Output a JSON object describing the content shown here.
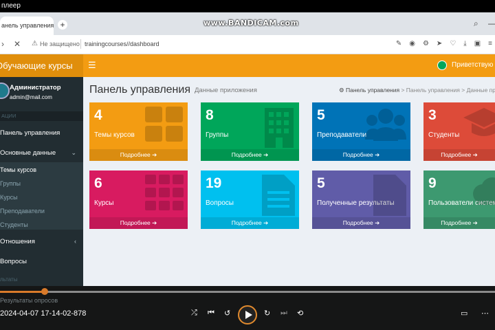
{
  "player": {
    "title": "плеер",
    "watermark": "www.BANDICAM.com",
    "filename": "2024-04-07 17-14-02-878",
    "progress_percent": 9
  },
  "browser": {
    "tab_title": "анель управления",
    "new_tab": "+",
    "not_secure": "Не защищено",
    "url": "trainingcourses//dashboard"
  },
  "app": {
    "brand": "Обучающие курсы",
    "greeting": "Приветствую В"
  },
  "sidebar": {
    "user_name": "Администратор",
    "user_email": "admin@mail.com",
    "section_header": "АЦИИ",
    "items": [
      {
        "label": "Панель управления"
      },
      {
        "label": "Основные данные"
      },
      {
        "label": "Отношения"
      },
      {
        "label": "Вопросы"
      },
      {
        "label": "льтаты"
      },
      {
        "label": "Результаты опросов"
      }
    ],
    "subitems": [
      {
        "label": "Темы курсов"
      },
      {
        "label": "Группы"
      },
      {
        "label": "Курсы"
      },
      {
        "label": "Преподаватели"
      },
      {
        "label": "Студенты"
      }
    ]
  },
  "content": {
    "title": "Панель управления",
    "subtitle": "Данные приложения",
    "breadcrumb": [
      "Панель управления",
      "Панель управления",
      "Данные пр"
    ],
    "more_label": "Подробнее",
    "boxes": [
      {
        "number": "4",
        "label": "Темы курсов",
        "color": "#f39c12"
      },
      {
        "number": "8",
        "label": "Группы",
        "color": "#00a65a"
      },
      {
        "number": "5",
        "label": "Преподаватели",
        "color": "#0073b7"
      },
      {
        "number": "3",
        "label": "Студенты",
        "color": "#dd4b39"
      },
      {
        "number": "6",
        "label": "Курсы",
        "color": "#d81b60"
      },
      {
        "number": "19",
        "label": "Вопросы",
        "color": "#00c0ef"
      },
      {
        "number": "5",
        "label": "Полученные результаты",
        "color": "#605ca8"
      },
      {
        "number": "9",
        "label": "Пользователи систем",
        "color": "#3d9970"
      }
    ]
  }
}
